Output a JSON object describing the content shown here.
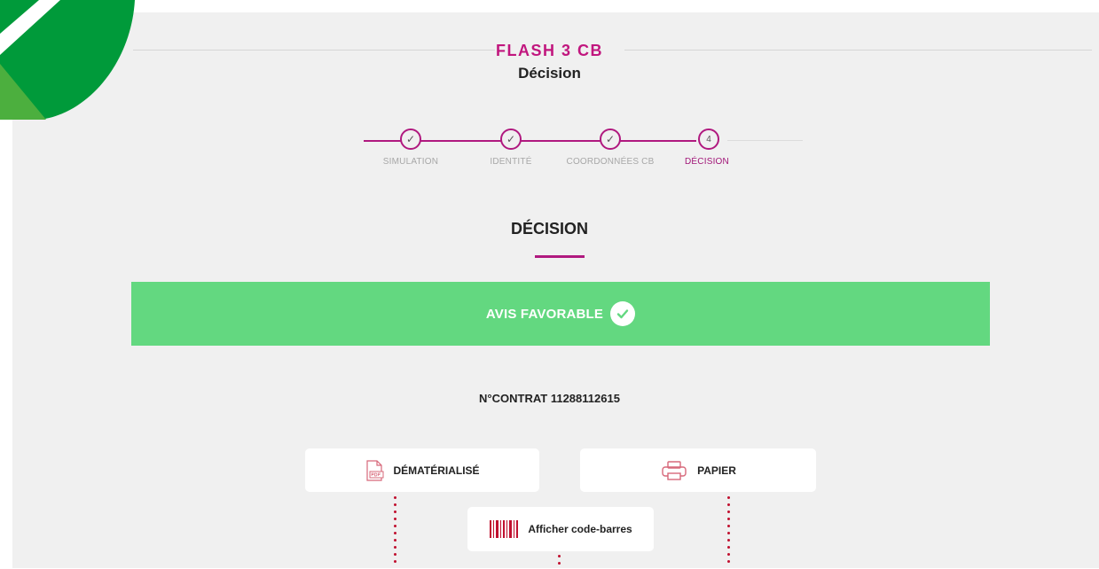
{
  "header": {
    "product_title": "FLASH 3 CB",
    "subtitle": "Décision"
  },
  "stepper": {
    "steps": [
      {
        "label": "SIMULATION",
        "state": "done",
        "marker": "✓"
      },
      {
        "label": "IDENTITÉ",
        "state": "done",
        "marker": "✓"
      },
      {
        "label": "COORDONNÉES CB",
        "state": "done",
        "marker": "✓"
      },
      {
        "label": "DÉCISION",
        "state": "current",
        "marker": "4"
      }
    ]
  },
  "section": {
    "title": "DÉCISION"
  },
  "banner": {
    "text": "AVIS FAVORABLE"
  },
  "contract": {
    "text": "N°CONTRAT 11288112615"
  },
  "buttons": {
    "dematerialise": "DÉMATÉRIALISÉ",
    "papier": "PAPIER",
    "barcode": "Afficher code-barres"
  },
  "icons": {
    "banner": "check-icon",
    "dematerialise": "pdf-document-icon",
    "papier": "printer-icon",
    "barcode": "barcode-icon"
  },
  "colors": {
    "accent": "#b0197f",
    "banner": "#63d880",
    "logo_green": "#009a3a",
    "icon_red": "#c0102f"
  }
}
